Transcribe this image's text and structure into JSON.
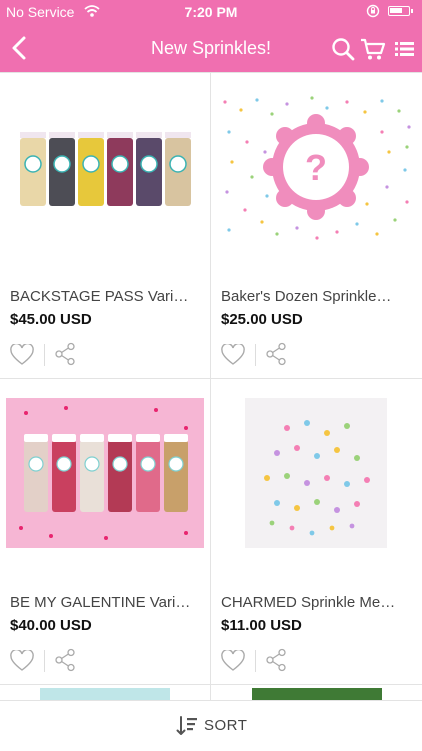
{
  "status_bar": {
    "carrier": "No Service",
    "time": "7:20 PM"
  },
  "nav": {
    "title": "New Sprinkles!",
    "icons": [
      "chevron-left-icon",
      "search-icon",
      "cart-icon",
      "list-icon"
    ]
  },
  "products": [
    {
      "name": "BACKSTAGE PASS Vari…",
      "price": "$45.00 USD"
    },
    {
      "name": "Baker's Dozen Sprinkle…",
      "price": "$25.00 USD"
    },
    {
      "name": "BE MY GALENTINE Vari…",
      "price": "$40.00 USD"
    },
    {
      "name": "CHARMED Sprinkle Me…",
      "price": "$11.00 USD"
    }
  ],
  "bottom": {
    "sort_label": "SORT"
  },
  "colors": {
    "brand": "#f06fb0"
  }
}
